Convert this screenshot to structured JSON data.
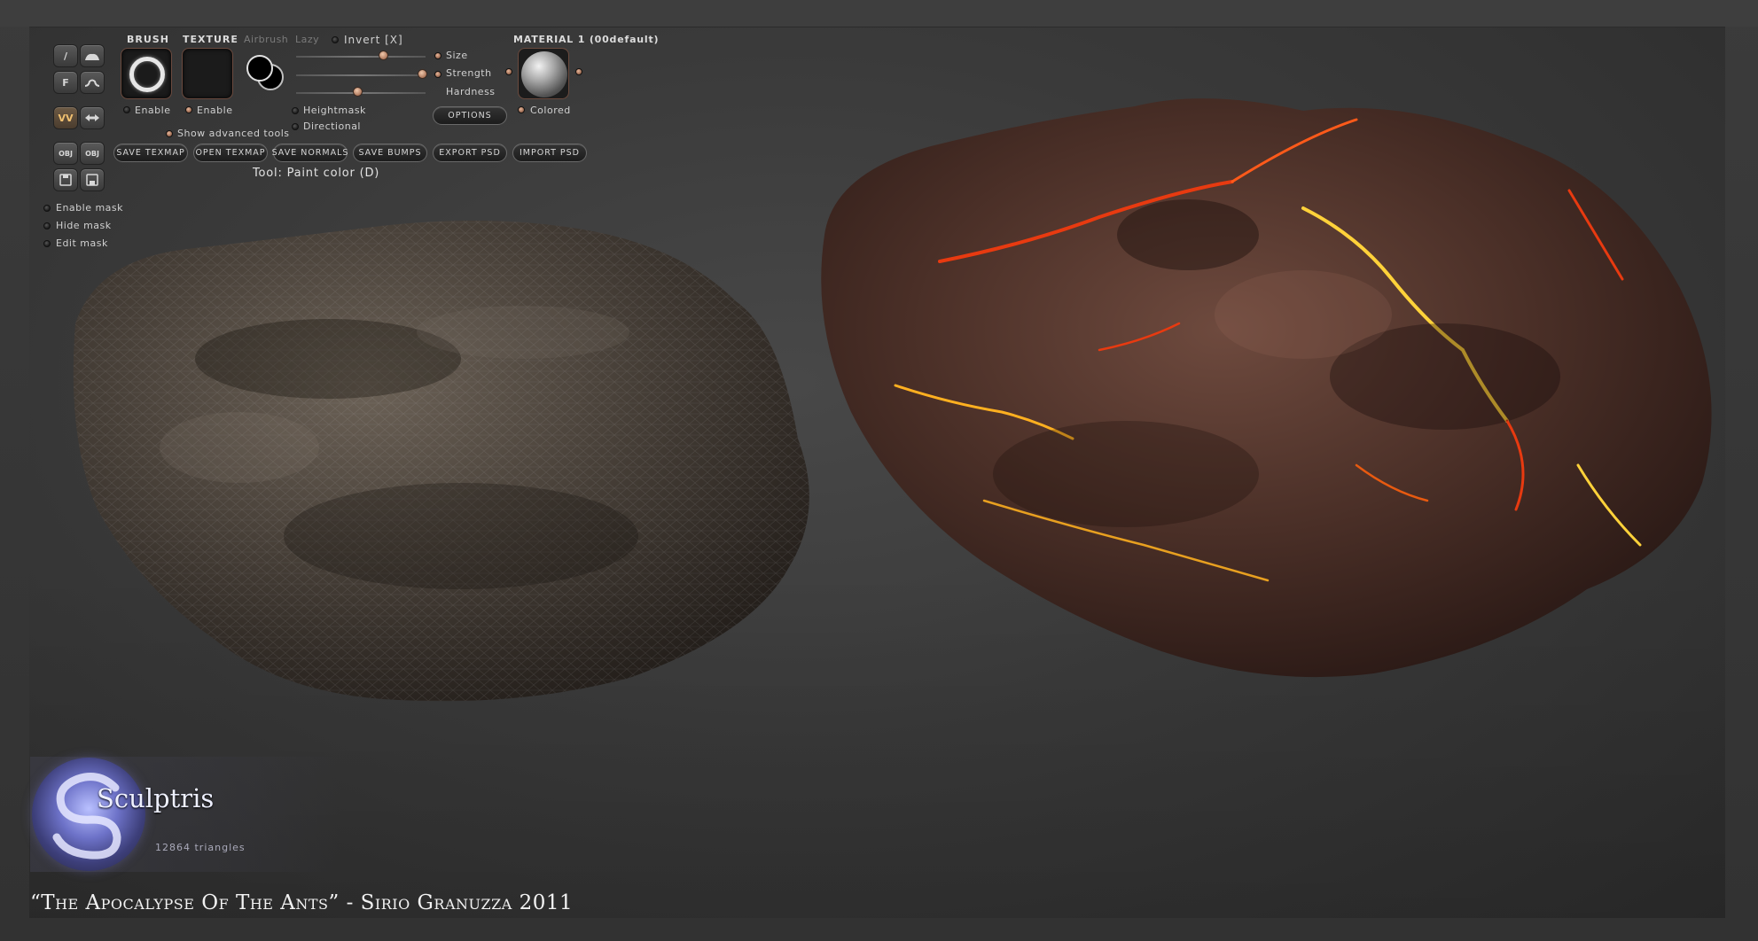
{
  "toolbar": {
    "brush": {
      "header": "BRUSH",
      "enable_label": "Enable"
    },
    "texture": {
      "header": "TEXTURE",
      "enable_label": "Enable"
    },
    "airbrush_label": "Airbrush",
    "lazy_label": "Lazy",
    "invert_label": "Invert [X]",
    "sliders": {
      "size_label": "Size",
      "strength_label": "Strength",
      "hardness_label": "Hardness",
      "size_value": 0.68,
      "strength_value": 0.98,
      "hardness_value": 0.48
    },
    "heightmask_label": "Heightmask",
    "directional_label": "Directional",
    "options_label": "OPTIONS",
    "show_advanced_label": "Show advanced tools",
    "material": {
      "header": "MATERIAL 1 (00default)",
      "colored_label": "Colored"
    },
    "buttons": {
      "save_texmap": "SAVE TEXMAP",
      "open_texmap": "OPEN TEXMAP",
      "save_normals": "SAVE NORMALS",
      "save_bumps": "SAVE BUMPS",
      "export_psd": "EXPORT PSD",
      "import_psd": "IMPORT PSD"
    },
    "tool_label": "Tool: Paint color (D)",
    "side_icons": {
      "brush_icon": "/",
      "flatten_icon": "F",
      "wave_icon": "VV",
      "obj_in": "OBJ",
      "obj_out": "OBJ"
    }
  },
  "mask": {
    "enable": "Enable mask",
    "hide": "Hide mask",
    "edit": "Edit mask"
  },
  "logo": {
    "name": "Sculptris",
    "triangles": "12864 triangles"
  },
  "caption": "“The Apocalypse Of The Ants” - Sirio Granuzza 2011",
  "colors": {
    "accent": "#a46c50",
    "lava_hot": "#ffd23a",
    "lava_red": "#e83a10"
  }
}
